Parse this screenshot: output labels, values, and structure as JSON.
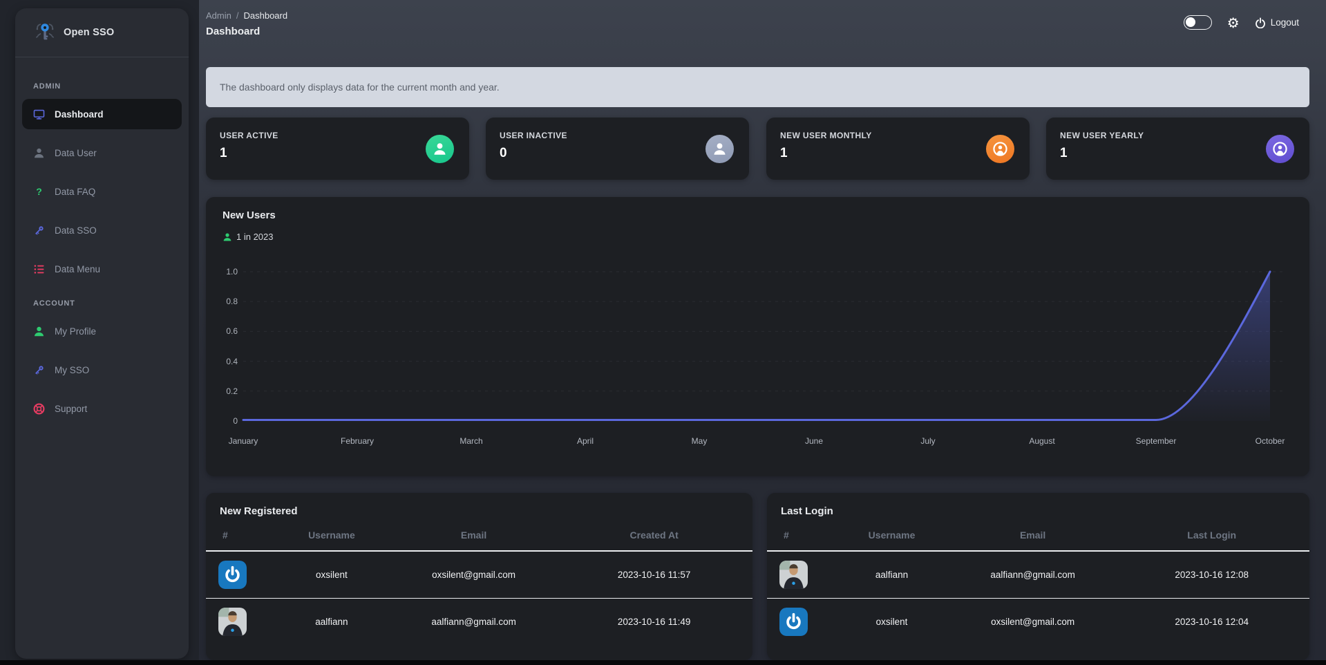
{
  "sidebar": {
    "logo_title": "Open SSO",
    "sections": [
      {
        "label": "ADMIN",
        "items": [
          {
            "label": "Dashboard",
            "icon": "monitor-icon",
            "color": "#5b68dd",
            "active": true
          },
          {
            "label": "Data User",
            "icon": "user-icon",
            "color": "#6b727e",
            "active": false
          },
          {
            "label": "Data FAQ",
            "icon": "question-icon",
            "color": "#2ecb70",
            "active": false
          },
          {
            "label": "Data SSO",
            "icon": "key-icon",
            "color": "#5b68dd",
            "active": false
          },
          {
            "label": "Data Menu",
            "icon": "list-icon",
            "color": "#e73c62",
            "active": false
          }
        ]
      },
      {
        "label": "ACCOUNT",
        "items": [
          {
            "label": "My Profile",
            "icon": "user-icon",
            "color": "#2ecb70",
            "active": false
          },
          {
            "label": "My SSO",
            "icon": "key-icon",
            "color": "#5b68dd",
            "active": false
          },
          {
            "label": "Support",
            "icon": "lifebuoy-icon",
            "color": "#e73c62",
            "active": false
          }
        ]
      }
    ]
  },
  "header": {
    "breadcrumb": {
      "parent": "Admin",
      "separator": "/",
      "current": "Dashboard"
    },
    "title": "Dashboard",
    "logout_label": "Logout"
  },
  "banner": {
    "text": "The dashboard only displays data for the current month and year."
  },
  "stats": [
    {
      "label": "USER ACTIVE",
      "value": "1",
      "icon": "user-solid-icon",
      "color_top": "#3ad897",
      "color_bottom": "#17c68c"
    },
    {
      "label": "USER INACTIVE",
      "value": "0",
      "icon": "user-solid-icon",
      "color_top": "#a6b0c6",
      "color_bottom": "#8d99b3"
    },
    {
      "label": "NEW USER MONTHLY",
      "value": "1",
      "icon": "user-circle-icon",
      "color_top": "#f6953f",
      "color_bottom": "#ee7622"
    },
    {
      "label": "NEW USER YEARLY",
      "value": "1",
      "icon": "user-circle-icon",
      "color_top": "#7c69e2",
      "color_bottom": "#5f4ccf"
    }
  ],
  "chart_data": {
    "type": "line",
    "title": "New Users",
    "legend": "1 in 2023",
    "legend_position": "top-left",
    "categories": [
      "January",
      "February",
      "March",
      "April",
      "May",
      "June",
      "July",
      "August",
      "September",
      "October"
    ],
    "series": [
      {
        "name": "2023",
        "values": [
          0,
          0,
          0,
          0,
          0,
          0,
          0,
          0,
          0,
          1
        ]
      }
    ],
    "yticks": [
      "1.0",
      "0.8",
      "0.6",
      "0.4",
      "0.2",
      "0"
    ],
    "ylim": [
      0,
      1
    ],
    "line_color": "#5b68dd",
    "fill": "vertical-gradient-under-line",
    "grid": "dashed-horizontal"
  },
  "tables": [
    {
      "title": "New Registered",
      "headers": [
        "#",
        "Username",
        "Email",
        "Created At"
      ],
      "rows": [
        {
          "avatar": "oxsilent-logo",
          "username": "oxsilent",
          "email": "oxsilent@gmail.com",
          "datetime": "2023-10-16 11:57"
        },
        {
          "avatar": "aalfiann-photo",
          "username": "aalfiann",
          "email": "aalfiann@gmail.com",
          "datetime": "2023-10-16 11:49"
        }
      ]
    },
    {
      "title": "Last Login",
      "headers": [
        "#",
        "Username",
        "Email",
        "Last Login"
      ],
      "rows": [
        {
          "avatar": "aalfiann-photo",
          "username": "aalfiann",
          "email": "aalfiann@gmail.com",
          "datetime": "2023-10-16 12:08"
        },
        {
          "avatar": "oxsilent-logo",
          "username": "oxsilent",
          "email": "oxsilent@gmail.com",
          "datetime": "2023-10-16 12:04"
        }
      ]
    }
  ],
  "colors": {
    "accent_line": "#5b68dd",
    "sidebar_bg": "#292c33",
    "card_bg": "#1d1f23",
    "banner_bg": "#d3d8e1",
    "green": "#2ecb70",
    "red": "#e73c62",
    "orange": "#ee7622",
    "purple": "#6f5cd6"
  }
}
